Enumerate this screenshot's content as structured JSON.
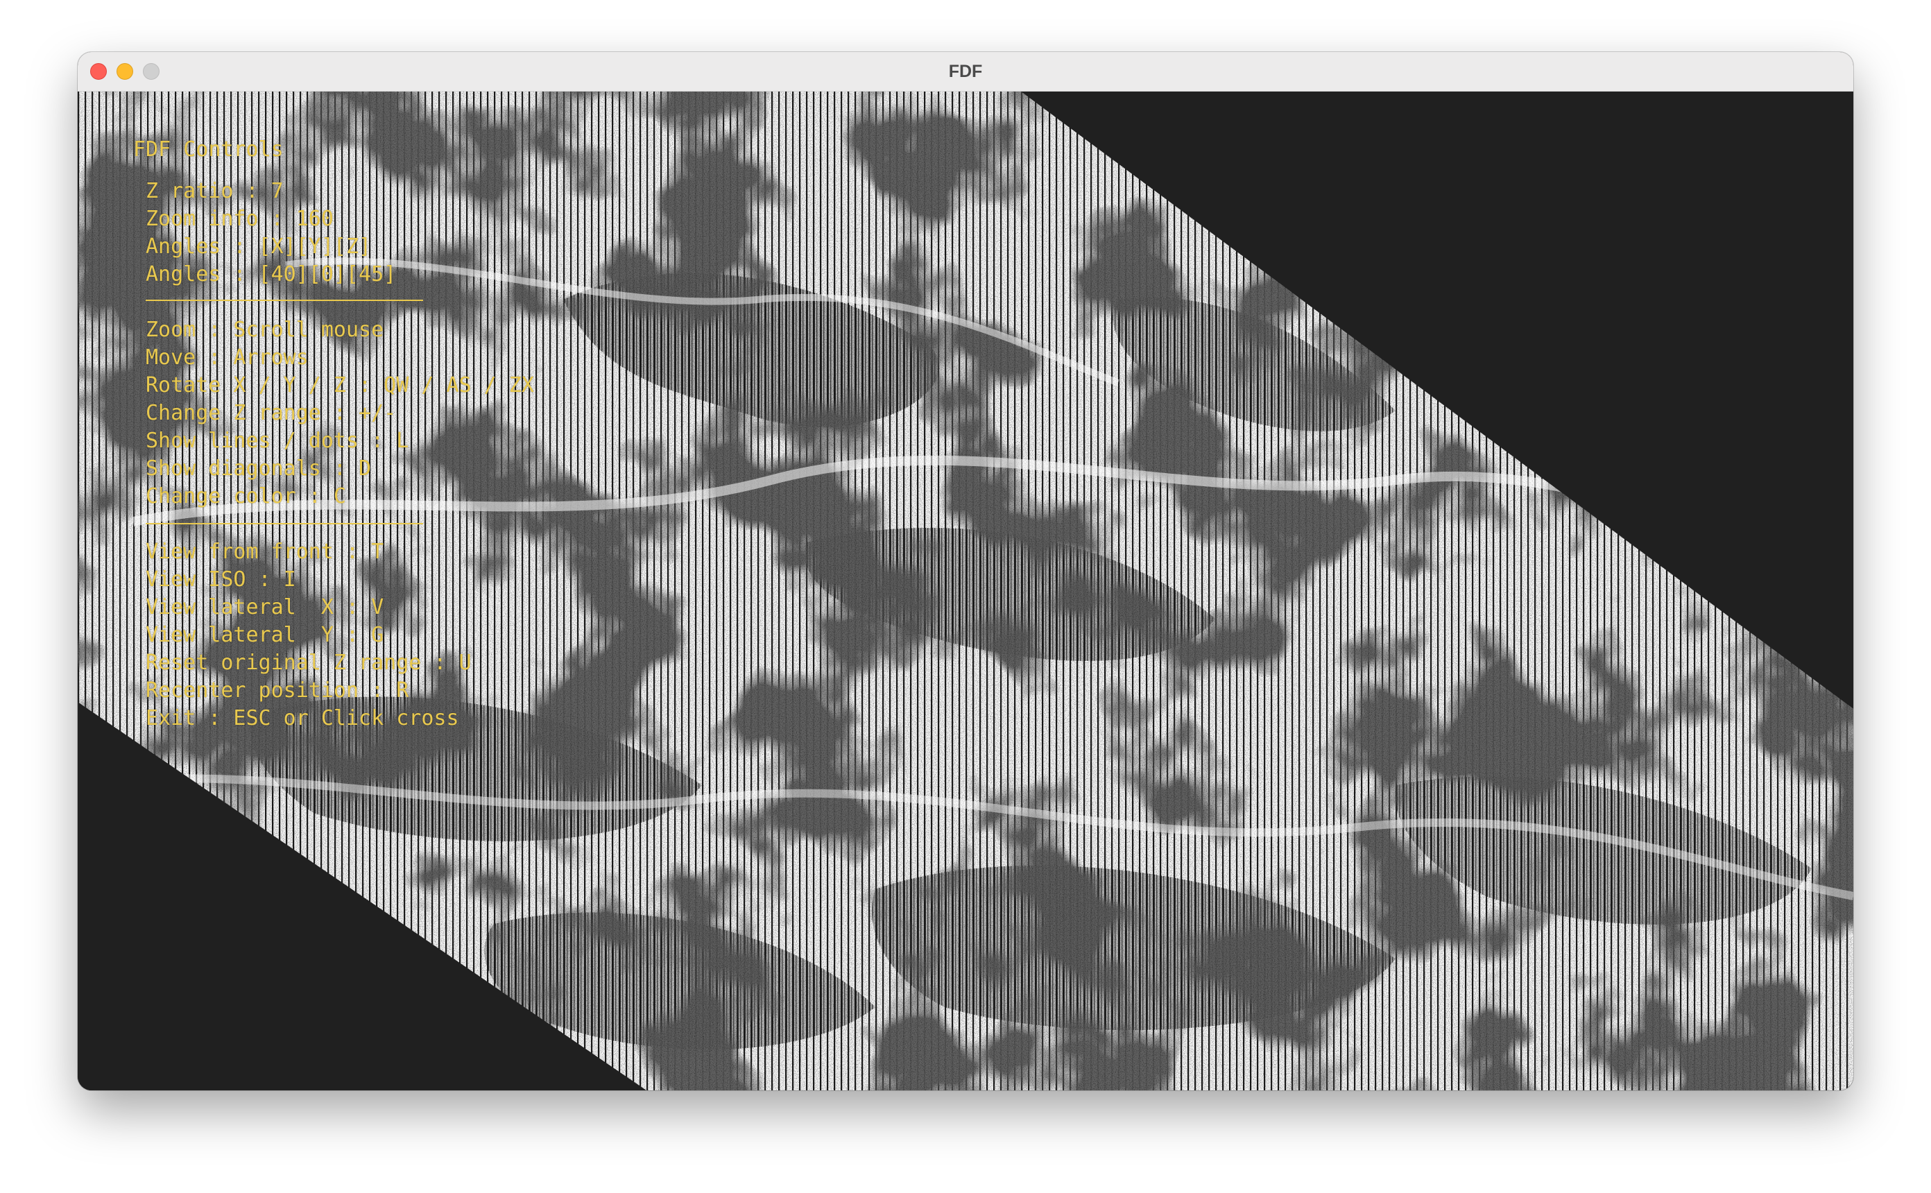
{
  "window": {
    "title": "FDF",
    "buttons": [
      "close-button",
      "minimize-button",
      "zoom-button"
    ]
  },
  "controls": {
    "heading": "FDF Controls",
    "info": [
      "Z ratio : 7",
      "Zoom info : 160",
      "Angles : [X][Y][Z]",
      "Angles : [40][0][45]"
    ],
    "commands": [
      "Zoom : Scroll mouse",
      "Move : Arrows",
      "Rotate X / Y / Z : QW / AS / ZX",
      "Change Z range : +/-",
      "Show lines / dots : L",
      "Show diagonals : D",
      "Change color : C"
    ],
    "views": [
      "View from front : T",
      "View ISO : I",
      "View lateral  X : V",
      "View lateral  Y : G",
      "Reset original Z range : U",
      "Recenter position : R",
      "Exit : ESC or Click cross"
    ],
    "text_color": "#e9c94e"
  },
  "colors": {
    "background": "#202020",
    "wireframe": "#ffffff",
    "titlebar": "#ecebeb"
  }
}
